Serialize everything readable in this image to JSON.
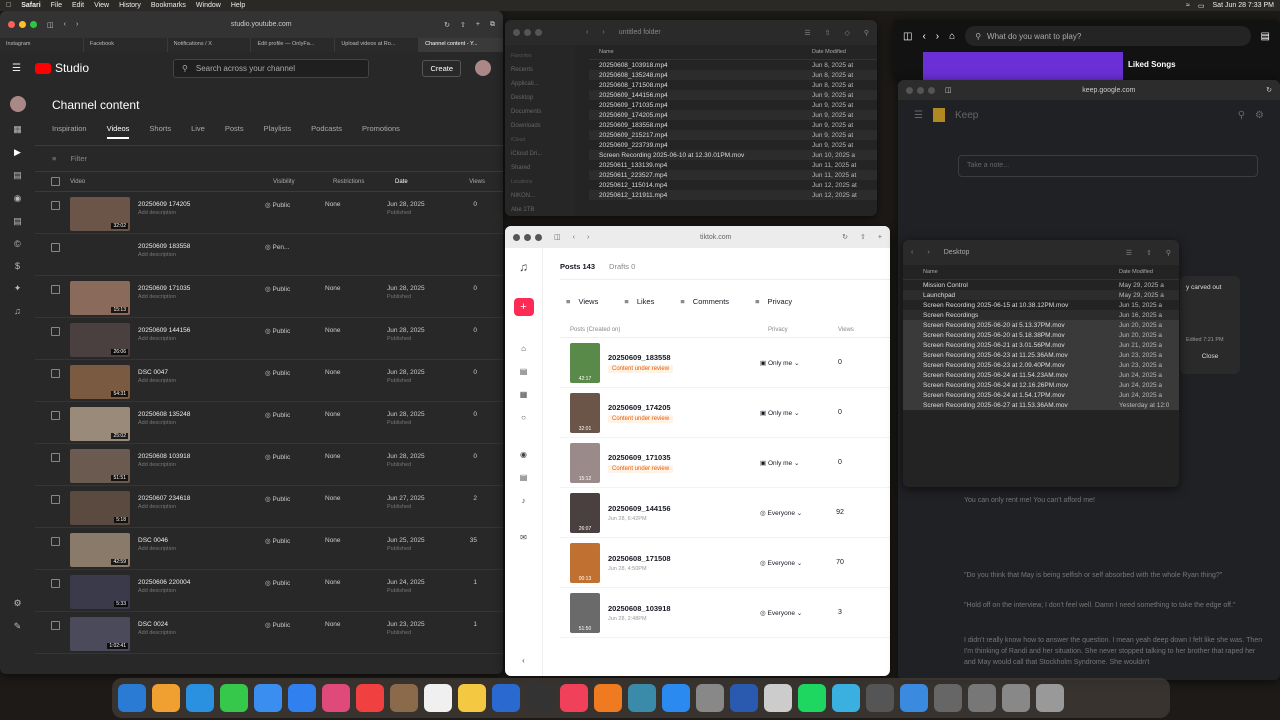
{
  "menubar": {
    "app": "Safari",
    "items": [
      "File",
      "Edit",
      "View",
      "History",
      "Bookmarks",
      "Window",
      "Help"
    ],
    "datetime": "Sat Jun 28 7:33 PM"
  },
  "youtube": {
    "url": "studio.youtube.com",
    "tabs": [
      "Instagram",
      "Facebook",
      "Notifications / X",
      "Edit profile — OnlyFa...",
      "Upload videos at Ro...",
      "Channel content - Y..."
    ],
    "logo": "Studio",
    "search_placeholder": "Search across your channel",
    "create_label": "Create",
    "page_title": "Channel content",
    "content_tabs": [
      "Inspiration",
      "Videos",
      "Shorts",
      "Live",
      "Posts",
      "Playlists",
      "Podcasts",
      "Promotions"
    ],
    "filter_placeholder": "Filter",
    "columns": [
      "Video",
      "Visibility",
      "Restrictions",
      "Date",
      "Views"
    ],
    "desc": "Add description",
    "published": "Published",
    "rows": [
      {
        "title": "20250609 174205",
        "dur": "32:02",
        "vis": "Public",
        "rest": "None",
        "date": "Jun 28, 2025",
        "views": "0",
        "color": "#6b5548"
      },
      {
        "title": "20250609 183558",
        "dur": "",
        "vis": "Pen...",
        "rest": "",
        "date": "",
        "views": "",
        "color": "#282828"
      },
      {
        "title": "20250609 171035",
        "dur": "15:13",
        "vis": "Public",
        "rest": "None",
        "date": "Jun 28, 2025",
        "views": "0",
        "color": "#8a6a5a"
      },
      {
        "title": "20250609 144156",
        "dur": "26:06",
        "vis": "Public",
        "rest": "None",
        "date": "Jun 28, 2025",
        "views": "0",
        "color": "#4a4040"
      },
      {
        "title": "DSC 0047",
        "dur": "54:31",
        "vis": "Public",
        "rest": "None",
        "date": "Jun 28, 2025",
        "views": "0",
        "color": "#7a5a40"
      },
      {
        "title": "20250608 135248",
        "dur": "25:02",
        "vis": "Public",
        "rest": "None",
        "date": "Jun 28, 2025",
        "views": "0",
        "color": "#9a8a7a"
      },
      {
        "title": "20250608 103918",
        "dur": "51:51",
        "vis": "Public",
        "rest": "None",
        "date": "Jun 28, 2025",
        "views": "0",
        "color": "#6a5a50"
      },
      {
        "title": "20250607 234618",
        "dur": "5:18",
        "vis": "Public",
        "rest": "None",
        "date": "Jun 27, 2025",
        "views": "2",
        "color": "#5a4a40"
      },
      {
        "title": "DSC 0046",
        "dur": "42:59",
        "vis": "Public",
        "rest": "None",
        "date": "Jun 25, 2025",
        "views": "35",
        "color": "#8a7a6a"
      },
      {
        "title": "20250606 220004",
        "dur": "5:33",
        "vis": "Public",
        "rest": "None",
        "date": "Jun 24, 2025",
        "views": "1",
        "color": "#3a3a4a"
      },
      {
        "title": "DSC 0024",
        "dur": "1:02:41",
        "vis": "Public",
        "rest": "None",
        "date": "Jun 23, 2025",
        "views": "1",
        "color": "#4a4a5a"
      }
    ]
  },
  "finder1": {
    "title": "untitled folder",
    "sidebar": [
      "Favorites",
      "Recents",
      "Applicati...",
      "Desktop",
      "Documents",
      "Downloads",
      "iCloud",
      "iCloud Dri...",
      "Shared",
      "Locations",
      "NIKON...",
      "Abe 1TB"
    ],
    "col_name": "Name",
    "col_date": "Date Modified",
    "files": [
      [
        "20250608_103918.mp4",
        "Jun 8, 2025 at"
      ],
      [
        "20250608_135248.mp4",
        "Jun 8, 2025 at"
      ],
      [
        "20250608_171508.mp4",
        "Jun 8, 2025 at"
      ],
      [
        "20250609_144156.mp4",
        "Jun 9, 2025 at"
      ],
      [
        "20250609_171035.mp4",
        "Jun 9, 2025 at"
      ],
      [
        "20250609_174205.mp4",
        "Jun 9, 2025 at"
      ],
      [
        "20250609_183558.mp4",
        "Jun 9, 2025 at"
      ],
      [
        "20250609_215217.mp4",
        "Jun 9, 2025 at"
      ],
      [
        "20250609_223739.mp4",
        "Jun 9, 2025 at"
      ],
      [
        "Screen Recording 2025-06-10 at 12.30.01PM.mov",
        "Jun 10, 2025 a"
      ],
      [
        "20250611_133139.mp4",
        "Jun 11, 2025 at"
      ],
      [
        "20250611_223527.mp4",
        "Jun 11, 2025 at"
      ],
      [
        "20250612_115014.mp4",
        "Jun 12, 2025 at"
      ],
      [
        "20250612_121911.mp4",
        "Jun 12, 2025 at"
      ]
    ]
  },
  "tiktok": {
    "url": "tiktok.com",
    "posts_tab": "Posts 143",
    "drafts_tab": "Drafts 0",
    "sort": [
      "Views",
      "Likes",
      "Comments",
      "Privacy"
    ],
    "columns": [
      "Posts (Created on)",
      "Privacy",
      "Views"
    ],
    "review": "Content under review",
    "rows": [
      {
        "title": "20250609_183558",
        "dur": "42:17",
        "sub": "",
        "review": true,
        "priv": "Only me",
        "views": "0",
        "color": "#5a8a4a"
      },
      {
        "title": "20250609_174205",
        "dur": "32:01",
        "sub": "",
        "review": true,
        "priv": "Only me",
        "views": "0",
        "color": "#6b5548"
      },
      {
        "title": "20250609_171035",
        "dur": "15:12",
        "sub": "",
        "review": true,
        "priv": "Only me",
        "views": "0",
        "color": "#9a8a8a"
      },
      {
        "title": "20250609_144156",
        "dur": "26:07",
        "sub": "Jun 28, 6:42PM",
        "review": false,
        "priv": "Everyone",
        "views": "92",
        "color": "#4a4040"
      },
      {
        "title": "20250608_171508",
        "dur": "00:13",
        "sub": "Jun 28, 4:50PM",
        "review": false,
        "priv": "Everyone",
        "views": "70",
        "color": "#c07030"
      },
      {
        "title": "20250608_103918",
        "dur": "51:50",
        "sub": "Jun 28, 2:48PM",
        "review": false,
        "priv": "Everyone",
        "views": "3",
        "color": "#6a6a6a"
      }
    ]
  },
  "spotify": {
    "search_placeholder": "What do you want to play?",
    "liked": "Liked Songs"
  },
  "keep": {
    "url": "keep.google.com",
    "title": "Keep",
    "note_placeholder": "Take a note...",
    "lines": [
      "You can only rent me! You can't afford me!",
      "\"Do you think that May is being selfish or self absorbed with the whole Ryan thing?\"",
      "\"Hold off on the interview, I don't feel well. Damn I need something to take the edge off.\"",
      "I didn't really know how to answer the question. I mean yeah deep down I felt like she was. Then I'm thinking of Randi and her situation. She never stopped talking to her brother that raped her and May would call that Stockholm Syndrome. She wouldn't"
    ]
  },
  "finder2": {
    "title": "Desktop",
    "col_name": "Name",
    "col_date": "Date Modified",
    "files": [
      [
        "Mission Control",
        "May 29, 2025 a"
      ],
      [
        "Launchpad",
        "May 29, 2025 a"
      ],
      [
        "Screen Recording 2025-06-15 at 10.38.12PM.mov",
        "Jun 15, 2025 a"
      ],
      [
        "Screen Recordings",
        "Jun 16, 2025 a"
      ],
      [
        "Screen Recording 2025-06-20 at 5.13.37PM.mov",
        "Jun 20, 2025 a"
      ],
      [
        "Screen Recording 2025-06-20 at 5.18.38PM.mov",
        "Jun 20, 2025 a"
      ],
      [
        "Screen Recording 2025-06-21 at 3.01.56PM.mov",
        "Jun 21, 2025 a"
      ],
      [
        "Screen Recording 2025-06-23 at 11.25.36AM.mov",
        "Jun 23, 2025 a"
      ],
      [
        "Screen Recording 2025-06-23 at 2.09.40PM.mov",
        "Jun 23, 2025 a"
      ],
      [
        "Screen Recording 2025-06-24 at 11.54.23AM.mov",
        "Jun 24, 2025 a"
      ],
      [
        "Screen Recording 2025-06-24 at 12.16.26PM.mov",
        "Jun 24, 2025 a"
      ],
      [
        "Screen Recording 2025-06-24 at 1.54.17PM.mov",
        "Jun 24, 2025 a"
      ],
      [
        "Screen Recording 2025-06-27 at 11.53.36AM.mov",
        "Yesterday at 12:0"
      ]
    ]
  },
  "dialog": {
    "text": "y carved out",
    "edited": "Edited 7:21 PM",
    "close": "Close"
  }
}
